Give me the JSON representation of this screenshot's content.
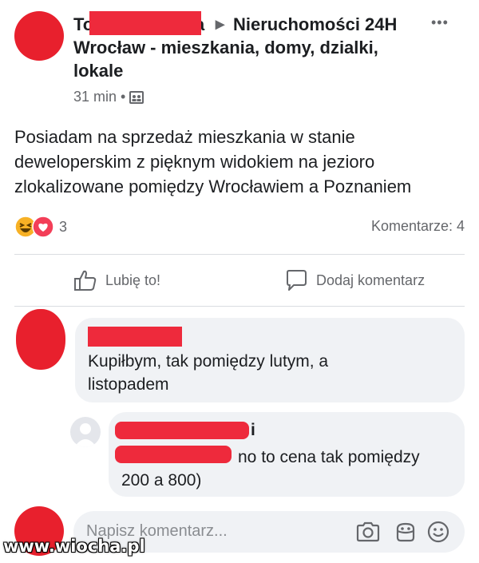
{
  "post": {
    "author_visible_start": "To",
    "author_visible_end": "a",
    "arrow": "▸",
    "group_line1": "Nieruchomości 24H",
    "group_line2": "Wrocław - mieszkania, domy, dzialki,",
    "group_line3": "lokale",
    "time": "31 min",
    "separator": "•",
    "menu": "•••",
    "text_line1": "Posiadam na sprzedaż mieszkania w stanie",
    "text_line2": "deweloperskim z pięknym widokiem na jezioro",
    "text_line3": "zlokalizowane pomiędzy Wrocławiem a Poznaniem",
    "reaction_count": "3",
    "comments_count": "Komentarze: 4"
  },
  "actions": {
    "like": "Lubię to!",
    "comment": "Dodaj komentarz"
  },
  "comments": [
    {
      "text_line1": "Kupiłbym, tak pomiędzy lutym, a",
      "text_line2": "listopadem"
    }
  ],
  "reply": {
    "name_end": "i",
    "text_line1": "no to cena tak pomiędzy",
    "text_line2": "200 a 800)"
  },
  "composer": {
    "placeholder": "Napisz komentarz..."
  },
  "watermark": "www.wiocha.pl",
  "colors": {
    "redaction": "#ee2a3c",
    "bubble": "#f0f2f5",
    "secondary_text": "#65676b",
    "reaction_haha": "#f7b125",
    "reaction_love": "#f33e58"
  }
}
